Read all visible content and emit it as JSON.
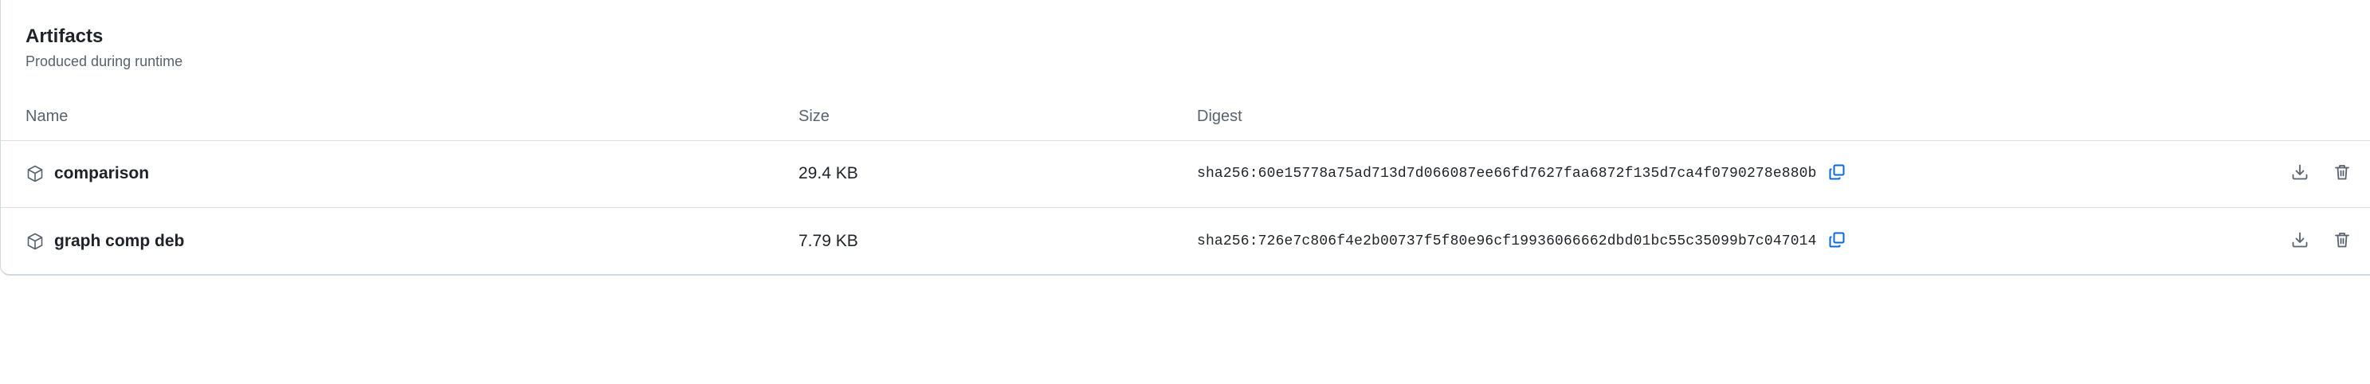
{
  "section": {
    "title": "Artifacts",
    "subtitle": "Produced during runtime"
  },
  "table": {
    "columns": {
      "name": "Name",
      "size": "Size",
      "digest": "Digest"
    },
    "rows": [
      {
        "name": "comparison",
        "size": "29.4 KB",
        "digest": "sha256:60e15778a75ad713d7d066087ee66fd7627faa6872f135d7ca4f0790278e880b"
      },
      {
        "name": "graph comp deb",
        "size": "7.79 KB",
        "digest": "sha256:726e7c806f4e2b00737f5f80e96cf19936066662dbd01bc55c35099b7c047014"
      }
    ]
  },
  "icons": {
    "row_icon": "package-icon",
    "copy": "copy-icon",
    "download": "download-icon",
    "delete": "trash-icon"
  },
  "colors": {
    "accent": "#0969da",
    "muted": "#59636e",
    "border": "#d1d9e0"
  }
}
